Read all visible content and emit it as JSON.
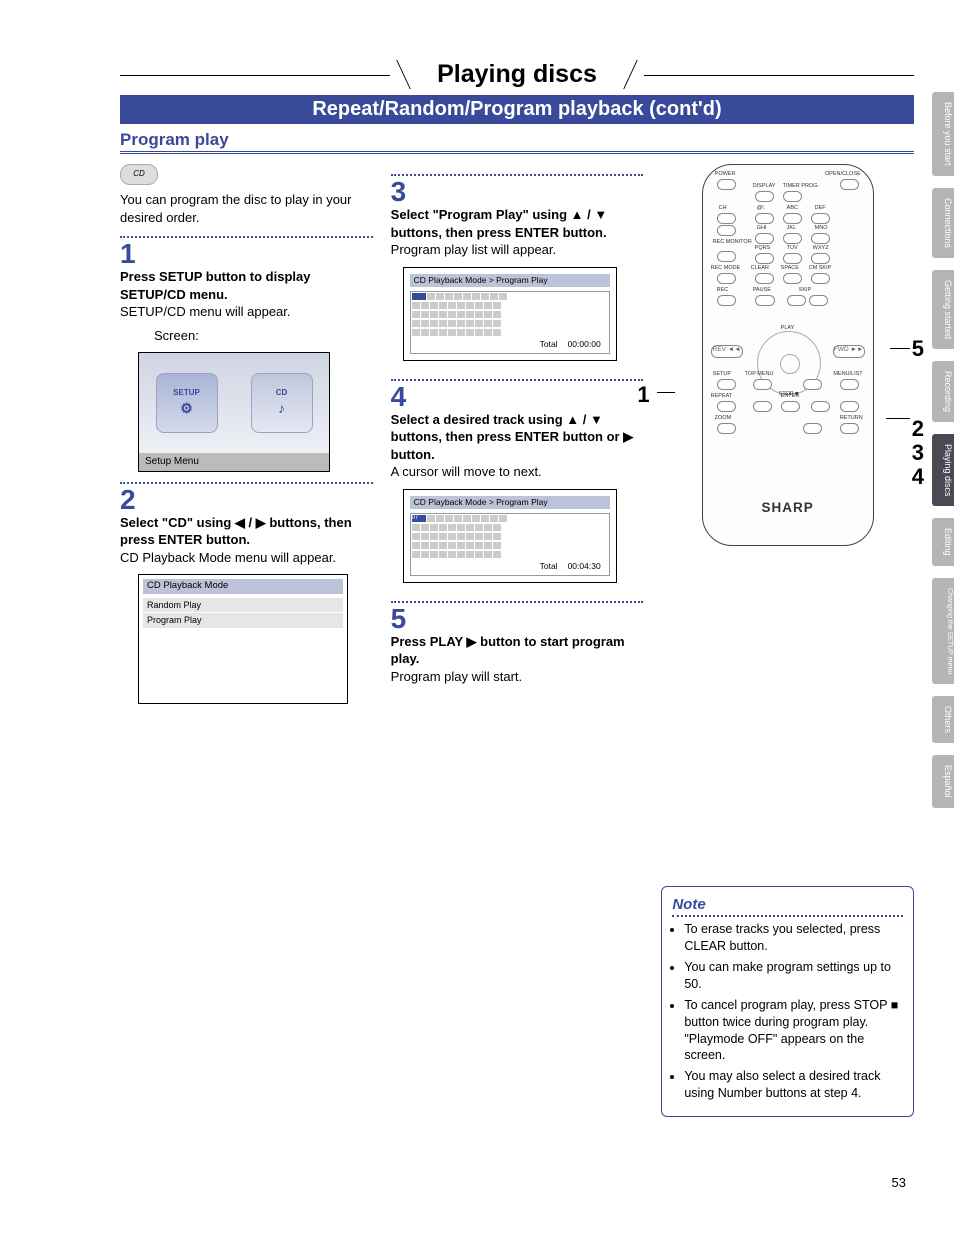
{
  "chapter_title": "Playing discs",
  "section_band": "Repeat/Random/Program playback (cont'd)",
  "subsection": "Program play",
  "badge": "CD",
  "col1": {
    "intro": "You can program the disc to play in your desired order.",
    "step1_num": "1",
    "step1_bold": "Press SETUP button to display SETUP/CD menu.",
    "step1_body": "SETUP/CD menu will appear.",
    "screen_label_top": "Screen:",
    "screen_blob_setup": "SETUP",
    "screen_blob_cd": "CD",
    "screen_caption": "Setup Menu",
    "step2_num": "2",
    "step2_bold": "Select \"CD\" using ◀ / ▶ buttons, then press ENTER button.",
    "step2_body": "CD Playback Mode menu will appear.",
    "menu_title": "CD Playback Mode",
    "menu_items": [
      "Random Play",
      "Program Play"
    ]
  },
  "col2": {
    "step3_num": "3",
    "step3_bold": "Select \"Program Play\" using ▲ / ▼ buttons, then press ENTER button.",
    "step3_body": "Program play list will appear.",
    "prog_title": "CD Playback Mode > Program Play",
    "prog_total_label": "Total",
    "prog_total_time_a": "00:00:00",
    "step4_num": "4",
    "step4_bold": "Select a desired track using ▲ / ▼ buttons, then press ENTER button or ▶ button.",
    "step4_body": "A cursor will move to next.",
    "prog_lead": "07",
    "prog_total_time_b": "00:04:30",
    "step5_num": "5",
    "step5_bold": "Press PLAY ▶ button to start program play.",
    "step5_body": "Program play will start."
  },
  "col3": {
    "remote_brand": "SHARP",
    "remote_play_label": "PLAY",
    "callouts": {
      "left_1": "1",
      "right_5": "5",
      "right_2": "2",
      "right_3": "3",
      "right_4": "4"
    },
    "note_title": "Note",
    "notes": [
      "To erase tracks you selected, press CLEAR button.",
      "You can make program settings up to 50.",
      "To cancel program play, press STOP ■ button twice during program play. \"Playmode OFF\" appears on the screen.",
      "You may also select a desired track using Number buttons at step 4."
    ]
  },
  "side_tabs": [
    {
      "label": "Before you start",
      "class": "tab-grey"
    },
    {
      "label": "Connections",
      "class": "tab-grey"
    },
    {
      "label": "Getting started",
      "class": "tab-grey"
    },
    {
      "label": "Recording",
      "class": "tab-grey"
    },
    {
      "label": "Playing discs",
      "class": "tab-dark"
    },
    {
      "label": "Editing",
      "class": "tab-grey"
    },
    {
      "label": "Changing the SETUP menu",
      "class": "tab-grey"
    },
    {
      "label": "Others",
      "class": "tab-grey"
    },
    {
      "label": "Español",
      "class": "tab-grey"
    }
  ],
  "page_number": "53"
}
